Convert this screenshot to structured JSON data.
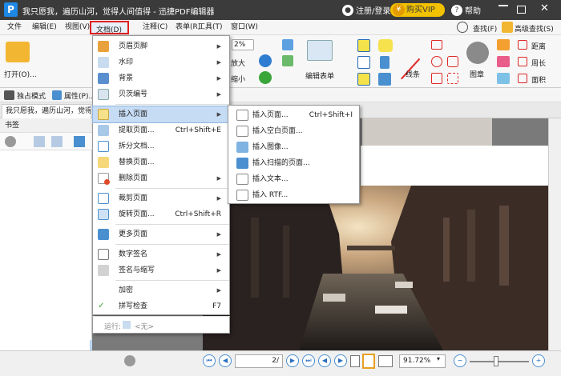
{
  "app": {
    "logo": "P",
    "title": "我只愿我，遍历山河，觉得人间值得 - 迅捷PDF编辑器",
    "login_label": "注册/登录",
    "vip_label": "购买VIP",
    "help_label": "帮助"
  },
  "menubar": [
    "文件",
    "编辑(E)",
    "视图(V)",
    "文档(D)",
    "注释(C)",
    "表单(R)",
    "工具(T)",
    "窗口(W)"
  ],
  "ribbon": {
    "open_label": "打开(O)...",
    "zoom_in_label": "放大",
    "zoom_out_label": "缩小",
    "zoom_value": "2%",
    "edit_form_label": "编辑表单",
    "lines_label": "线条",
    "stamp_label": "图章",
    "distance_label": "距离",
    "perimeter_label": "周长",
    "area_label": "面积",
    "find_label": "查找(F)",
    "advanced_find_label": "高级查找(S)"
  },
  "toolbar2": {
    "solo_mode_label": "独占模式",
    "properties_label": "属性(P)..."
  },
  "tab": {
    "label": "我只愿我，遍历山河，觉得人"
  },
  "sidebar": {
    "header": "书签"
  },
  "document_menu": {
    "items": [
      {
        "label": "页眉页脚",
        "shortcut": "",
        "arrow": true
      },
      {
        "label": "水印",
        "shortcut": "",
        "arrow": true
      },
      {
        "label": "背景",
        "shortcut": "",
        "arrow": true
      },
      {
        "label": "贝茨编号",
        "shortcut": "",
        "arrow": true
      },
      {
        "label": "插入页面",
        "shortcut": "",
        "arrow": true
      },
      {
        "label": "提取页面...",
        "shortcut": "Ctrl+Shift+E",
        "arrow": false
      },
      {
        "label": "拆分文档...",
        "shortcut": "",
        "arrow": false
      },
      {
        "label": "替换页面...",
        "shortcut": "",
        "arrow": false
      },
      {
        "label": "删除页面",
        "shortcut": "",
        "arrow": true
      },
      {
        "label": "裁剪页面",
        "shortcut": "",
        "arrow": true
      },
      {
        "label": "旋转页面...",
        "shortcut": "Ctrl+Shift+R",
        "arrow": false
      },
      {
        "label": "更多页面",
        "shortcut": "",
        "arrow": true
      },
      {
        "label": "数字签名",
        "shortcut": "",
        "arrow": true
      },
      {
        "label": "签名与缩写",
        "shortcut": "",
        "arrow": true
      },
      {
        "label": "加密",
        "shortcut": "",
        "arrow": true
      },
      {
        "label": "拼写检查",
        "shortcut": "F7",
        "arrow": false
      }
    ],
    "run_label": "运行:",
    "run_value": "<无>"
  },
  "insert_submenu": {
    "items": [
      {
        "label": "插入页面...",
        "shortcut": "Ctrl+Shift+I"
      },
      {
        "label": "插入空白页面...",
        "shortcut": ""
      },
      {
        "label": "插入图像...",
        "shortcut": ""
      },
      {
        "label": "插入扫描的页面...",
        "shortcut": ""
      },
      {
        "label": "插入文本...",
        "shortcut": ""
      },
      {
        "label": "插入 RTF...",
        "shortcut": ""
      }
    ]
  },
  "status": {
    "page_value": "2/",
    "zoom_value": "91.72%"
  },
  "colors": {
    "titlebar": "#3b3b3b",
    "vip": "#f2c100",
    "menu_highlight": "#c6dcf4",
    "active_menu_border": "#e02020",
    "accent_blue": "#2c6fbf"
  }
}
